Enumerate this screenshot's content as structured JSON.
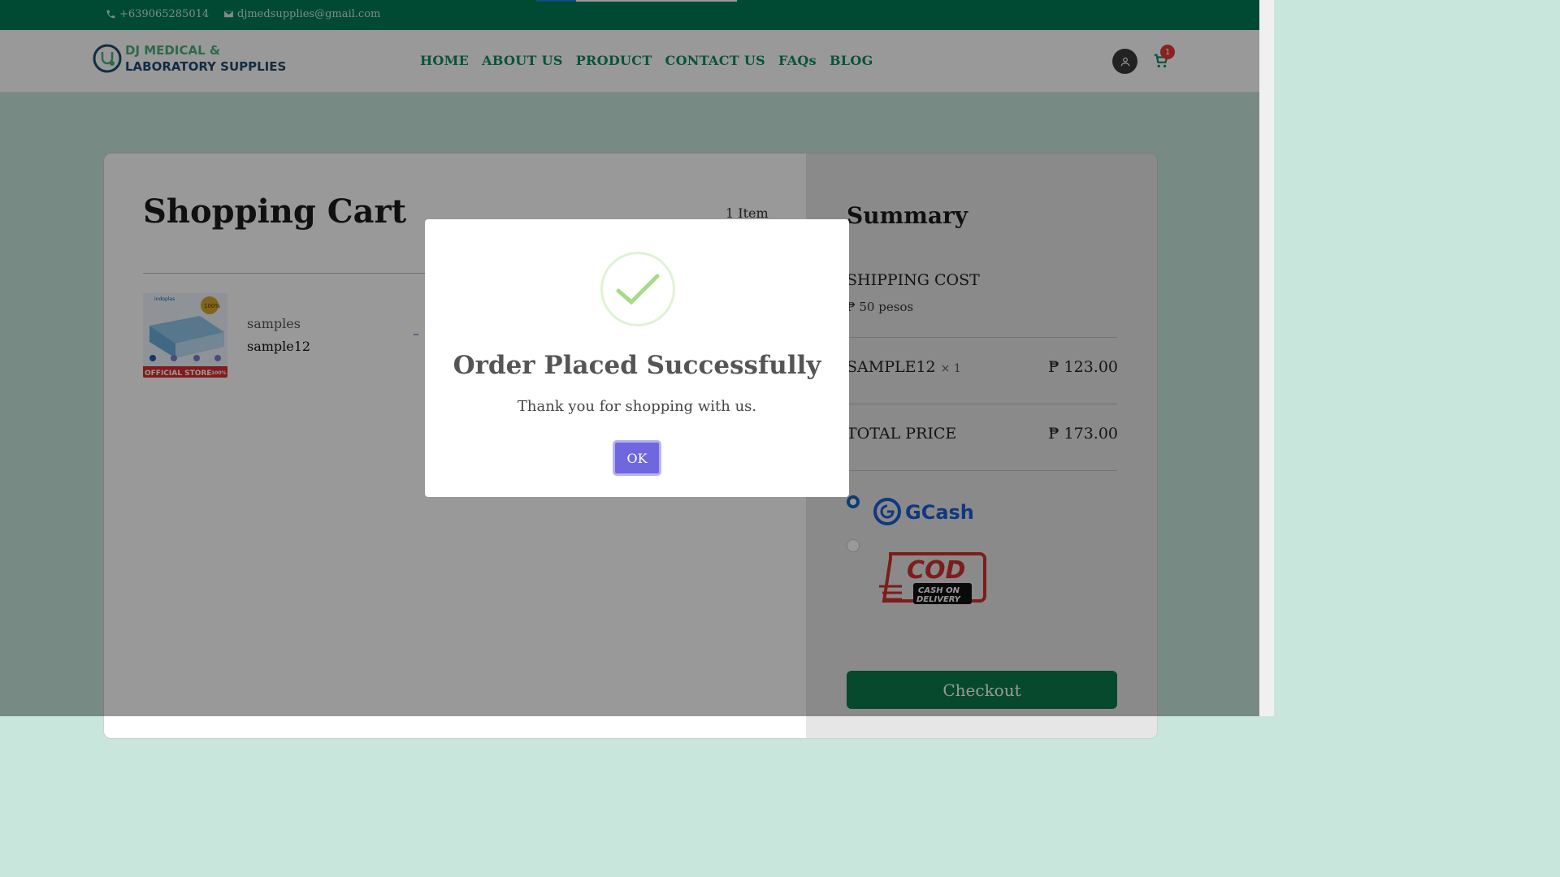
{
  "topbar": {
    "phone": "+639065285014",
    "email": "djmedsupplies@gmail.com",
    "loading_progress": 0.2
  },
  "header": {
    "logo_line1": "DJ MEDICAL &",
    "logo_line2": "LABORATORY SUPPLIES",
    "nav": [
      "HOME",
      "ABOUT US",
      "PRODUCT",
      "CONTACT US",
      "FAQs",
      "BLOG"
    ],
    "cart_count": "1"
  },
  "cart": {
    "title": "Shopping Cart",
    "item_count": "1 Item",
    "items": [
      {
        "category": "samples",
        "name": "sample12",
        "qty_control": "–"
      }
    ],
    "product_image_text": {
      "brand": "indoplas",
      "seal": "100%",
      "banner": "OFFICIAL STORE",
      "banner_badge": "100%"
    }
  },
  "summary": {
    "title": "Summary",
    "shipping_label": "SHIPPING COST",
    "shipping_value": "₱ 50 pesos",
    "line_item_name": "SAMPLE12",
    "line_item_qty": "× 1",
    "line_item_price": "₱ 123.00",
    "total_label": "TOTAL PRICE",
    "total_price": "₱ 173.00",
    "payment_options": [
      "GCash",
      "COD"
    ],
    "payment_logos": {
      "gcash": "GCash",
      "cod_main": "COD",
      "cod_line1": "CASH ON",
      "cod_line2": "DELIVERY"
    },
    "selected_payment": "GCash",
    "checkout_label": "Checkout"
  },
  "modal": {
    "title": "Order Placed Successfully",
    "message": "Thank you for shopping with us.",
    "ok_label": "OK"
  },
  "colors": {
    "topbar": "#007a55",
    "nav_link": "#0f8a63",
    "checkout": "#0a7a4a",
    "ok_button": "#7066e0",
    "success_check": "#a5dc86"
  },
  "icons": [
    "phone-icon",
    "mail-icon",
    "user-icon",
    "cart-icon",
    "success-check-icon"
  ]
}
